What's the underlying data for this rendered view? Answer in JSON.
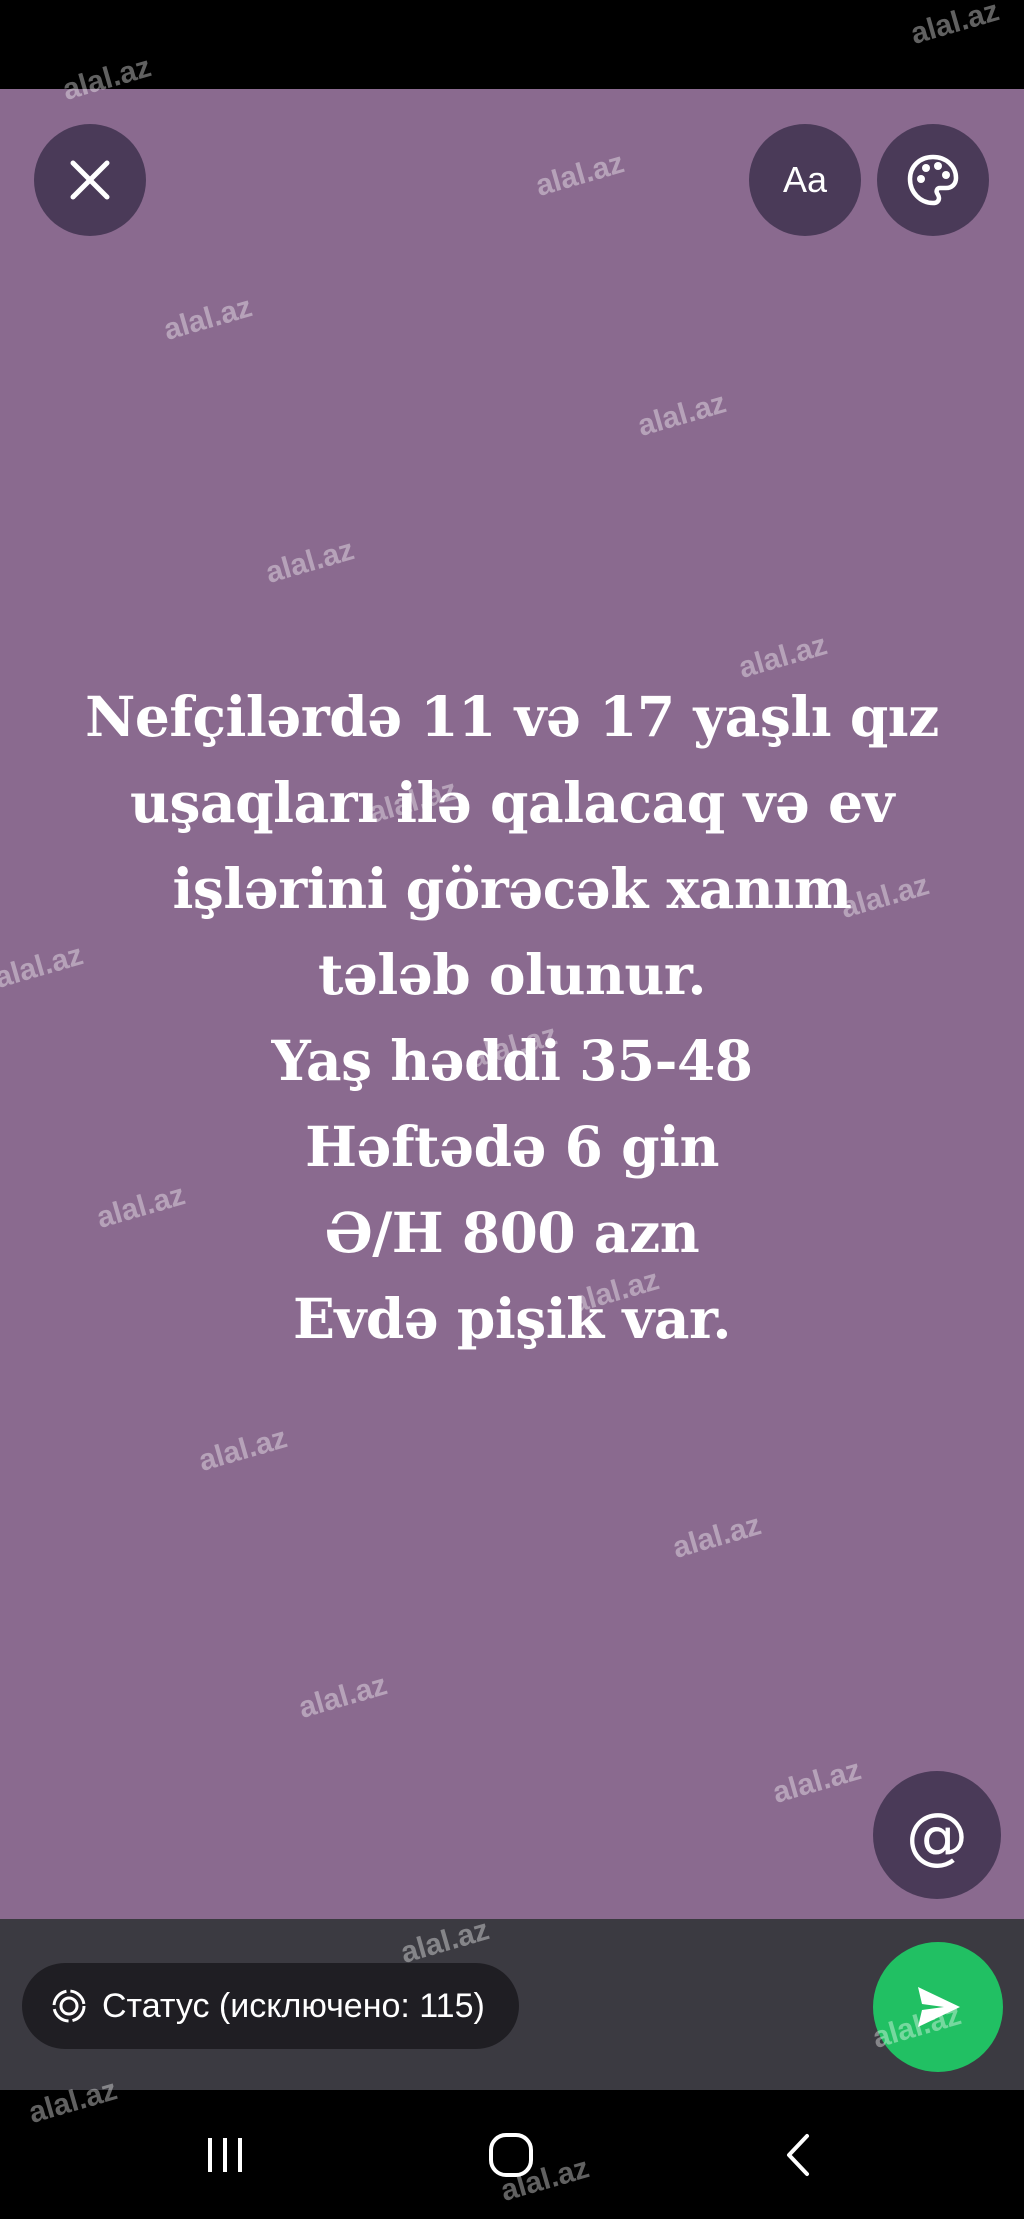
{
  "theme": {
    "background": "#8a6a8f",
    "button_bg": "#4a3a58",
    "send_color": "#21c063",
    "compose_bar_bg": "#3b3a41"
  },
  "toolbar": {
    "close_icon": "close-icon",
    "font_label": "Aa",
    "palette_icon": "palette-icon"
  },
  "status": {
    "lines": [
      "Nefçilərdə 11 və 17 yaşlı qız",
      "uşaqları ilə qalacaq və ev",
      "işlərini görəcək xanım",
      "tələb olunur.",
      "Yaş həddi 35-48",
      "Həftədə 6 gin",
      "Ə/H 800 azn",
      "Evdə pişik var."
    ]
  },
  "mention_label": "@",
  "compose": {
    "audience_label": "Статус (исключено: 115)",
    "audience_icon": "status-ring-icon",
    "send_icon": "send-icon"
  },
  "nav": {
    "recent_icon": "recent-apps-icon",
    "home_icon": "home-icon",
    "back_icon": "back-icon"
  },
  "watermark_text": "alal.az"
}
